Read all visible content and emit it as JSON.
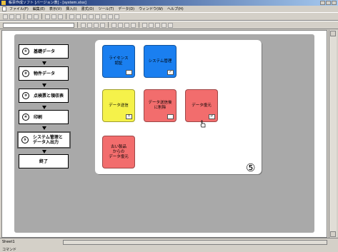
{
  "window": {
    "title": "帳票作成ソフト [バージョン表] - [system.xlsx]"
  },
  "menubar": {
    "items": [
      "ファイル(F)",
      "編集(E)",
      "表示(V)",
      "挿入(I)",
      "書式(O)",
      "ツール(T)",
      "データ(D)",
      "ウィンドウ(W)",
      "ヘルプ(H)"
    ]
  },
  "nav": {
    "items": [
      {
        "num": "①",
        "label": "基礎データ"
      },
      {
        "num": "②",
        "label": "物件データ"
      },
      {
        "num": "③",
        "label": "点検票と領収表"
      },
      {
        "num": "④",
        "label": "印刷"
      },
      {
        "num": "⑤",
        "label": "システム管理と\nデータ入出力"
      },
      {
        "num": "",
        "label": "終了"
      }
    ]
  },
  "tiles": {
    "license": "ライセンス\n認証",
    "system": "システム管理",
    "data_send": "データ送信",
    "data_send_after": "データ送信後\nに削除",
    "data_restore": "データ復元",
    "old_data": "古い製品\nからの\nデータ復元"
  },
  "panel_number": "⑤",
  "status": {
    "sheet_tab": "Sheet1",
    "text": "コマンド"
  },
  "colors": {
    "blue": "#1a7ff0",
    "yellow": "#f5f24a",
    "red": "#f26d6d",
    "slide_bg": "#a9a9a9"
  }
}
